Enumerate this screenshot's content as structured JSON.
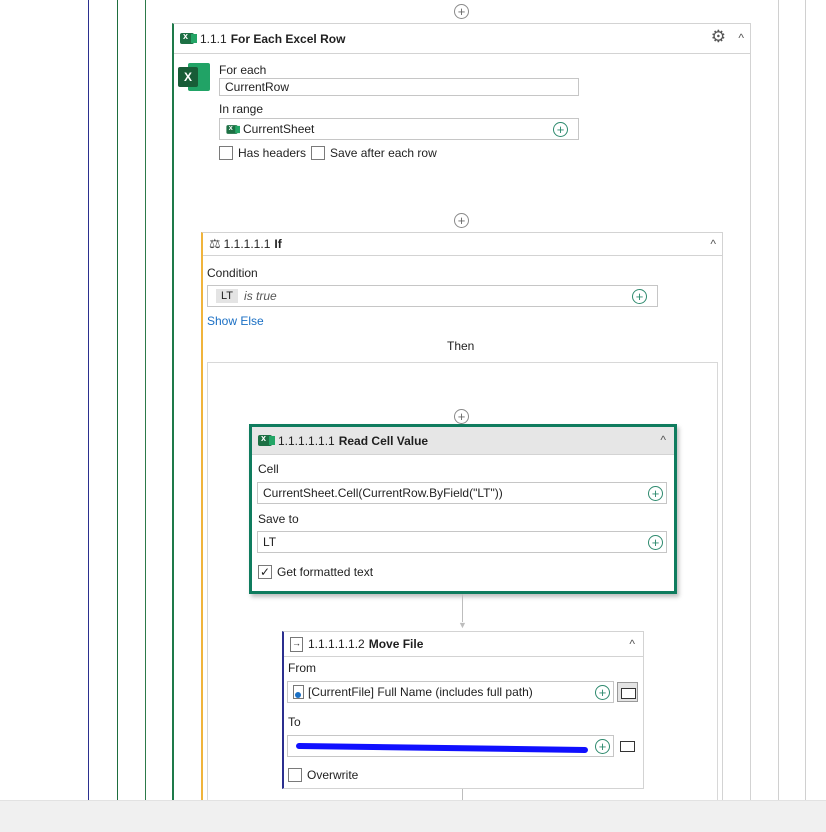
{
  "colors": {
    "nav_line": "#2b2f8f",
    "accent_green": "#0f7c5e",
    "if_border": "#f0b43c",
    "excel_green": "#1d7044"
  },
  "for_each": {
    "index": "1.1.1",
    "title": "For Each Excel Row",
    "icon": "excel-icon",
    "for_each_label": "For each",
    "for_each_value": "CurrentRow",
    "in_range_label": "In range",
    "in_range_value": "CurrentSheet",
    "has_headers_label": "Has headers",
    "save_after_label": "Save after each row"
  },
  "if_block": {
    "index": "1.1.1.1.1",
    "title": "If",
    "condition_label": "Condition",
    "condition_token": "LT",
    "condition_text": "is true",
    "show_else": "Show Else",
    "then_label": "Then"
  },
  "read_cell": {
    "index": "1.1.1.1.1.1",
    "title": "Read Cell Value",
    "cell_label": "Cell",
    "cell_value": "CurrentSheet.Cell(CurrentRow.ByField(\"LT\"))",
    "save_to_label": "Save to",
    "save_to_value": "LT",
    "formatted_label": "Get formatted text",
    "formatted_checked": true
  },
  "move_file": {
    "index": "1.1.1.1.1.2",
    "title": "Move File",
    "from_label": "From",
    "from_value": "[CurrentFile] Full Name (includes full path)",
    "to_label": "To",
    "overwrite_label": "Overwrite"
  }
}
